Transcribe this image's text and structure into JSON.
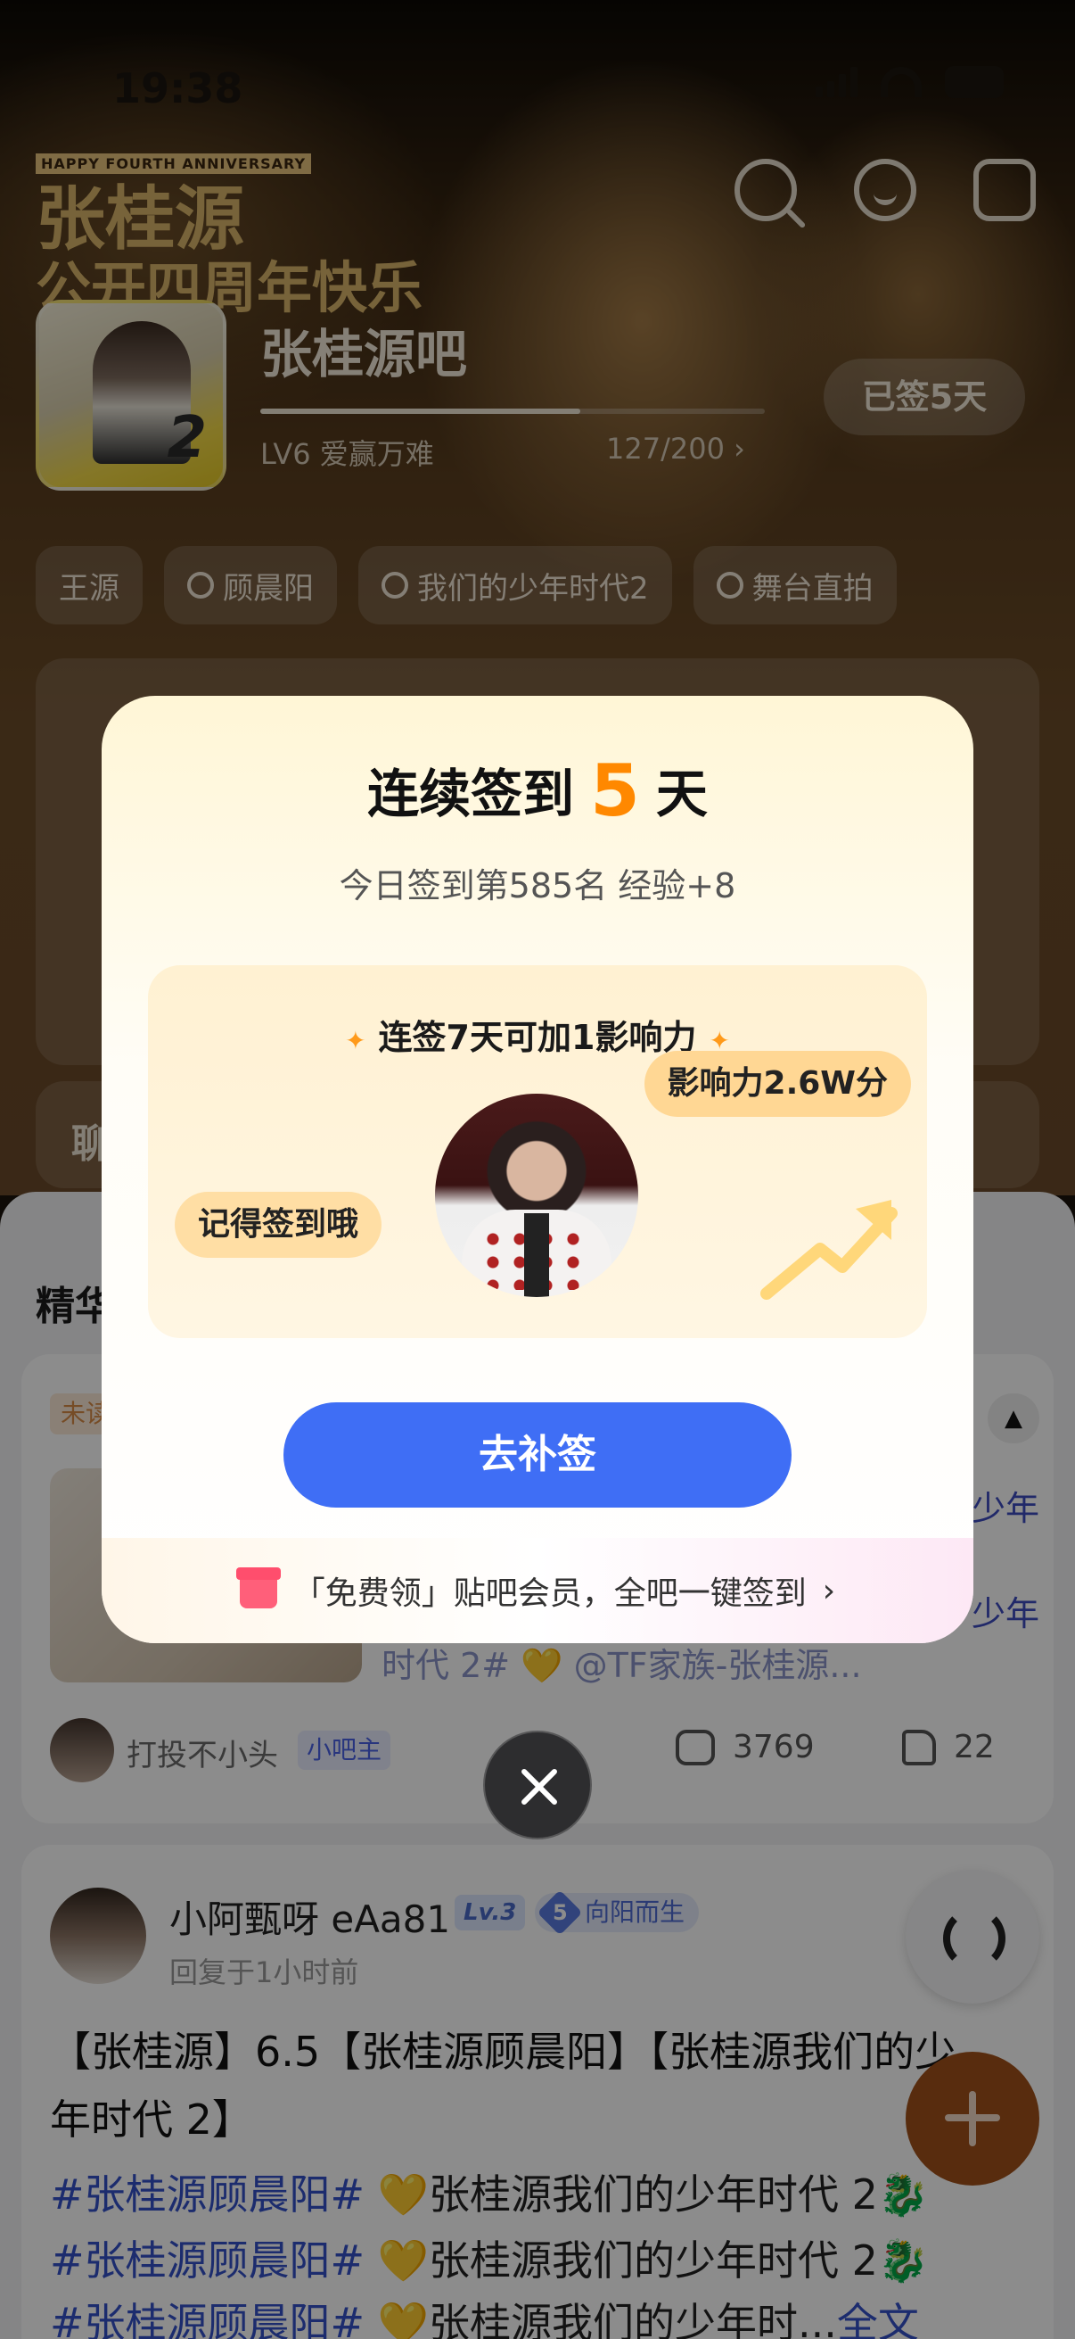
{
  "status_bar": {
    "time": "19:38"
  },
  "hero": {
    "anniversary_tag": "HAPPY FOURTH ANNIVERSARY",
    "anniversary_line1": "张桂源",
    "anniversary_line2": "公开四周年快乐"
  },
  "forum": {
    "name": "张桂源吧",
    "level_text": "LV6 爱赢万难",
    "exp_text": "127/200",
    "exp_progress": 0.635,
    "signed_label": "已签5天",
    "cover_number": "2"
  },
  "chips": [
    {
      "label": "王源",
      "search": false
    },
    {
      "label": "顾晨阳",
      "search": true
    },
    {
      "label": "我们的少年时代2",
      "search": true
    },
    {
      "label": "舞台直拍",
      "search": true
    }
  ],
  "chat_section": {
    "label": "聊"
  },
  "feed": {
    "tab_label": "精华",
    "post1": {
      "tag": "未读",
      "text_line_a": "少年",
      "text_line_b": "少年",
      "text_line_c": "时代 2# 💛 @TF家族-张桂源...",
      "author": "打投不小头",
      "author_badge": "小吧主",
      "comments": "3769",
      "likes": "22"
    },
    "post2": {
      "author": "小阿甄呀 eAa81",
      "level": "Lv.3",
      "medal_num": "5",
      "medal_label": "向阳而生",
      "time": "回复于1小时前",
      "title": "【张桂源】6.5【张桂源顾晨阳】【张桂源我们的少年时代 2】",
      "line1_tag": "#张桂源顾晨阳#",
      "line1_rest": "💛张桂源我们的少年时代 2🐉",
      "line2_tag": "#张桂源顾晨阳#",
      "line2_rest": "💛张桂源我们的少年时代 2🐉",
      "line3_tag": "#张桂源顾晨阳#",
      "line3_rest": "💛张桂源我们的少年时...",
      "more": "全文"
    }
  },
  "modal": {
    "title_prefix": "连续签到",
    "days": "5",
    "title_suffix": "天",
    "subtitle": "今日签到第585名 经验+8",
    "box_title": "连签7天可加1影响力",
    "bubble_left": "记得签到哦",
    "bubble_right": "影响力2.6W分",
    "button": "去补签",
    "footer": "「免费领」贴吧会员，全吧一键签到"
  },
  "colors": {
    "accent_orange": "#ff8800",
    "button_blue": "#3f6ef5",
    "link_blue": "#3450c9"
  }
}
